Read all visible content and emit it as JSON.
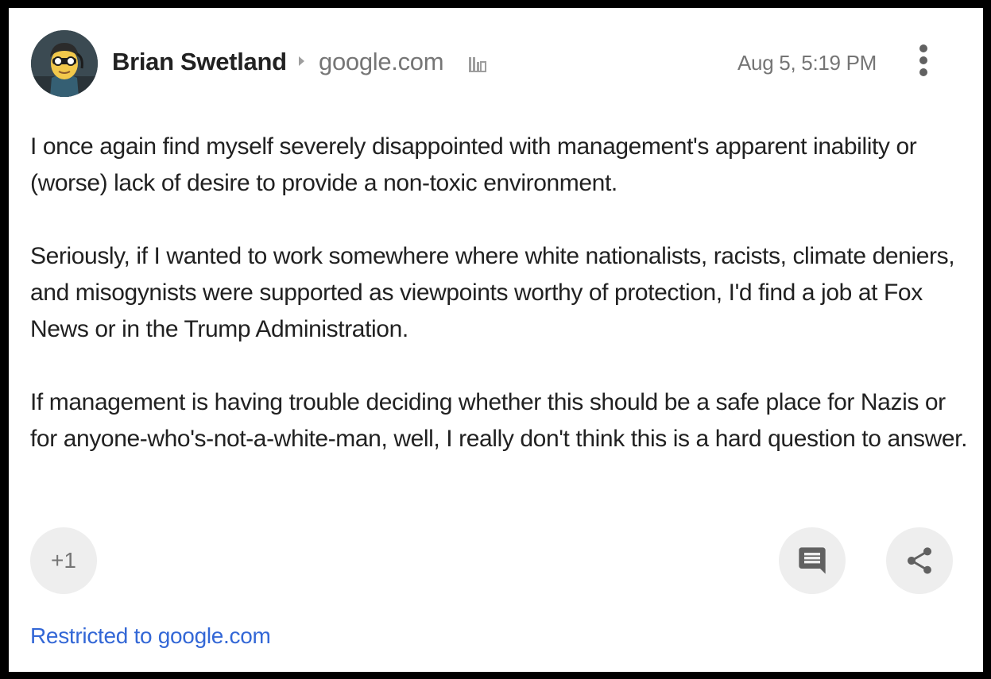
{
  "post": {
    "author": "Brian Swetland",
    "community": "google.com",
    "timestamp": "Aug 5, 5:19 PM",
    "paragraphs": [
      "I once again find myself severely disappointed with management's apparent inability or (worse) lack of desire to provide a non-toxic environment.",
      "Seriously, if I wanted to work somewhere where white nationalists, racists, climate deniers, and misogynists were supported as viewpoints worthy of protection, I'd find a job at Fox News or in the Trump Administration.",
      "If management is having trouble deciding whether this should be a safe place for Nazis or for anyone-who's-not-a-white-man, well, I really don't think this is a hard question to answer."
    ],
    "visibility": "Restricted to google.com"
  },
  "actions": {
    "plus_one_label": "+1"
  },
  "icons": {
    "avatar": "cartoon-avatar-icon",
    "separator": "chevron-right-icon",
    "domain": "domain-building-icon",
    "menu": "more-vert-icon",
    "comment": "comment-icon",
    "share": "share-icon"
  },
  "colors": {
    "text_primary": "#212121",
    "text_secondary": "#757575",
    "link": "#3367d6",
    "button_bg": "#eeeeee"
  }
}
